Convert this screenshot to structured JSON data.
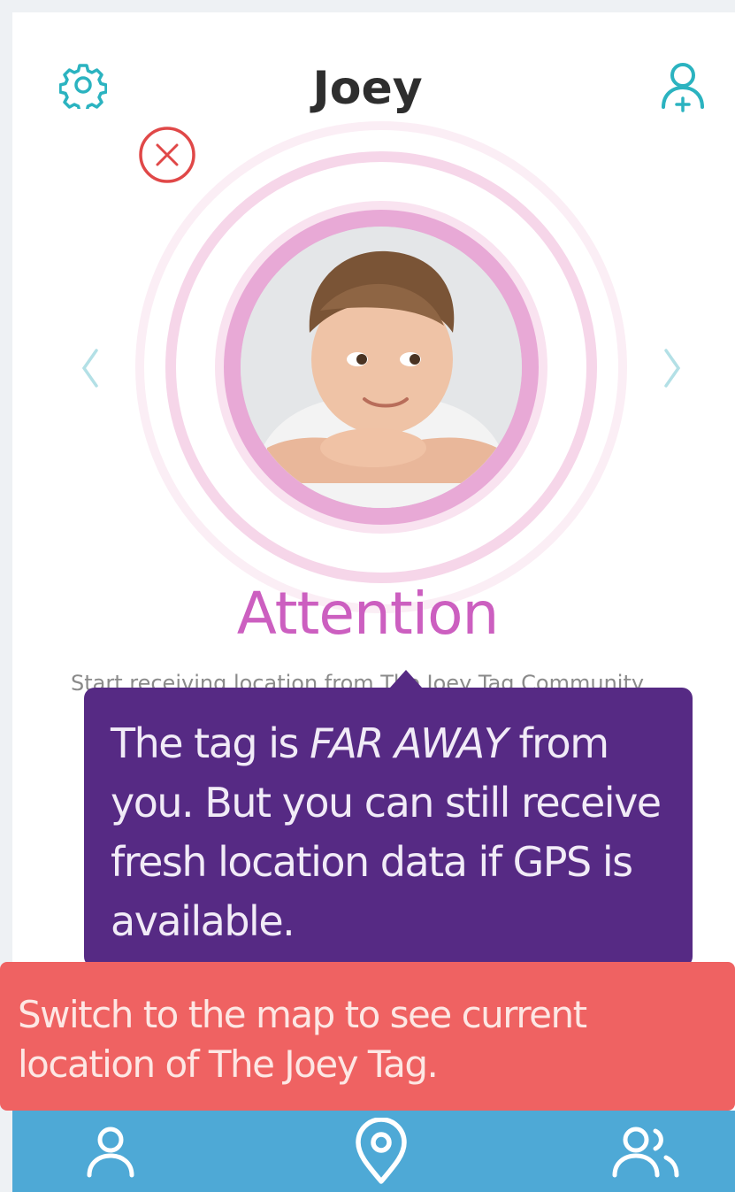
{
  "header": {
    "title": "Joey",
    "settings_icon": "gear-icon",
    "add_user_icon": "add-user-icon"
  },
  "profile": {
    "close_icon": "close-circle-icon",
    "prev_icon": "chevron-left-icon",
    "next_icon": "chevron-right-icon",
    "photo": "child-portrait"
  },
  "status": {
    "heading": "Attention",
    "subtext": "Start receiving location from The Joey Tag Community"
  },
  "tooltip_far_away": {
    "text_before": "The tag is ",
    "emphasis": "FAR AWAY",
    "text_after": " from you. But you can still receive fresh location data if GPS is available."
  },
  "tooltip_map": {
    "text": "Switch to the map to see current location of The Joey Tag."
  },
  "bottom_nav": {
    "items": [
      {
        "icon": "person-icon"
      },
      {
        "icon": "map-pin-icon"
      },
      {
        "icon": "group-icon"
      }
    ]
  },
  "colors": {
    "accent_teal": "#2bb3c0",
    "attention_pink": "#cc5fc0",
    "tooltip_purple": "#562a84",
    "tooltip_red": "#ef6262",
    "nav_blue": "#4ea9d6",
    "close_red": "#e04848"
  }
}
